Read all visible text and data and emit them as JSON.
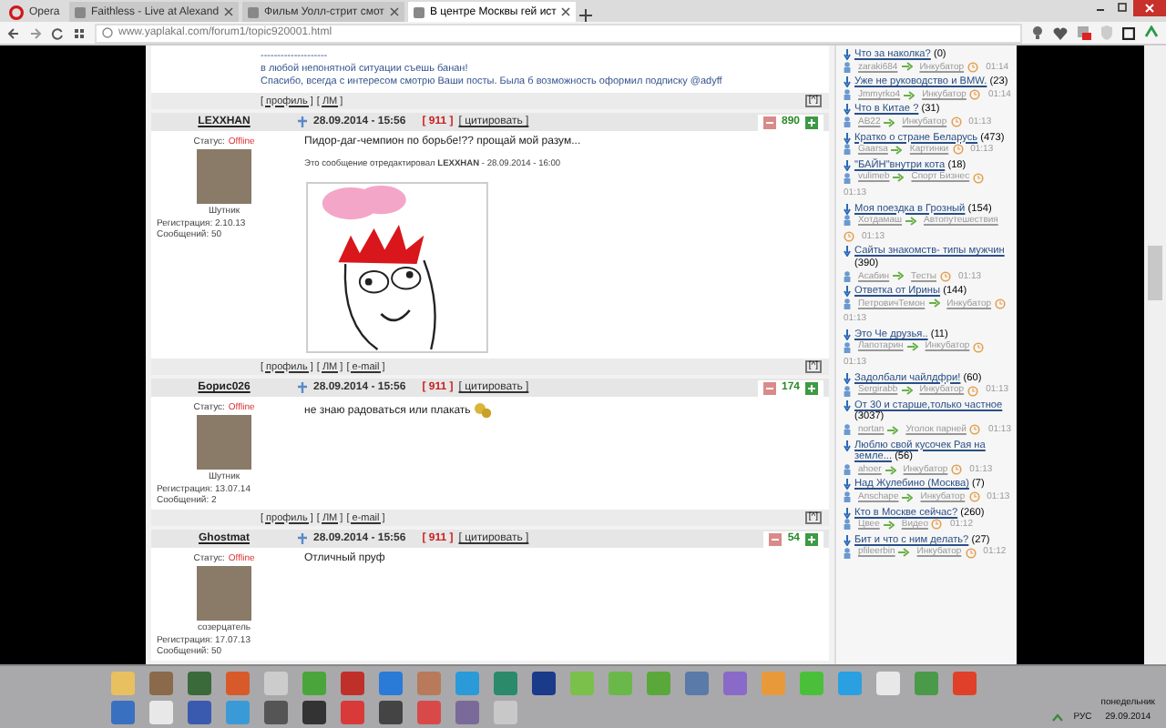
{
  "browser": {
    "tabs": [
      {
        "label": "Opera",
        "kind": "menu",
        "selected": false
      },
      {
        "label": "Faithless - Live at Alexand",
        "kind": "page",
        "selected": false
      },
      {
        "label": "Фильм Уолл-стрит смот",
        "kind": "page",
        "selected": false
      },
      {
        "label": "В центре Москвы гей ист",
        "kind": "page",
        "selected": true
      }
    ],
    "address": "www.yaplakal.com/forum1/topic920001.html"
  },
  "forum": {
    "top_fragment": {
      "lines": [
        "--------------------",
        "в любой непонятной ситуации съешь банан!",
        "Спасибо, всегда с интересом смотрю Ваши посты. Была б возможность оформил подписку @adyff"
      ],
      "links": [
        "[ профиль ]",
        "[ ЛМ ]"
      ],
      "top_button": "[^]"
    },
    "posts": [
      {
        "user": "LEXXHAN",
        "status_label": "Статус:",
        "status": "Offline",
        "rank": "Шутник",
        "registered": "Регистрация: 2.10.13",
        "messages": "Сообщений: 50",
        "date": "28.09.2014 - 15:56",
        "number": "[ 911 ]",
        "quote": "[ цитировать ]",
        "rating": "890",
        "text": "Пидор-даг-чемпион по борьбе!?? прощай мой разум...",
        "edited": "Это сообщение отредактировал **LEXXHAN** - 28.09.2014 - 16:00",
        "has_image": true,
        "has_emoticon": false,
        "links": [
          "[ профиль ]",
          "[ ЛМ ]",
          "[ e-mail ]"
        ],
        "top_button": "[^]"
      },
      {
        "user": "Борис026",
        "status_label": "Статус:",
        "status": "Offline",
        "rank": "Шутник",
        "registered": "Регистрация: 13.07.14",
        "messages": "Сообщений: 2",
        "date": "28.09.2014 - 15:56",
        "number": "[ 911 ]",
        "quote": "[ цитировать ]",
        "rating": "174",
        "text": "не знаю радоваться или плакать",
        "has_image": false,
        "has_emoticon": true,
        "links": [
          "[ профиль ]",
          "[ ЛМ ]",
          "[ e-mail ]"
        ],
        "top_button": "[^]"
      },
      {
        "user": "Ghostmat",
        "status_label": "Статус:",
        "status": "Offline",
        "rank": "созерцатель",
        "registered": "Регистрация: 17.07.13",
        "messages": "Сообщений: 50",
        "date": "28.09.2014 - 15:56",
        "number": "[ 911 ]",
        "quote": "[ цитировать ]",
        "rating": "54",
        "text": "Отличный пруф",
        "has_image": false,
        "has_emoticon": false
      }
    ]
  },
  "sidebar": {
    "topics": [
      {
        "title": "Что за наколка?",
        "count": "(0)",
        "author": "zaraki684",
        "forum": "Инкубатор",
        "time": "01:14"
      },
      {
        "title": "Уже не руководство и BMW.",
        "count": "(23)",
        "author": "Jmmyrko4",
        "forum": "Инкубатор",
        "time": "01:14"
      },
      {
        "title": "Что в Китае ?",
        "count": "(31)",
        "author": "AB22",
        "forum": "Инкубатор",
        "time": "01:13"
      },
      {
        "title": "Кратко о стране Беларусь",
        "count": "(473)",
        "author": "Gaarsa",
        "forum": "Картинки",
        "time": "01:13"
      },
      {
        "title": "\"БАЙН\"внутри кота",
        "count": "(18)",
        "author": "vulimeb",
        "forum": "Спорт Бизнес",
        "time": "01:13"
      },
      {
        "title": "Моя поездка в Грозный",
        "count": "(154)",
        "author": "Хотдамаш",
        "forum": "Автопутешествия",
        "time": "01:13"
      },
      {
        "title": "Сайты знакомств- типы мужчин",
        "count": "(390)",
        "author": "Асабин",
        "forum": "Тесты",
        "time": "01:13"
      },
      {
        "title": "Ответка от Ирины",
        "count": "(144)",
        "author": "ПетровичТемон",
        "forum": "Инкубатор",
        "time": "01:13"
      },
      {
        "title": "Это Че друзья..",
        "count": "(11)",
        "author": "Лапотарин",
        "forum": "Инкубатор",
        "time": "01:13"
      },
      {
        "title": "Задолбали чайлдфри!",
        "count": "(60)",
        "author": "Sergirabb",
        "forum": "Инкубатор",
        "time": "01:13"
      },
      {
        "title": "От 30 и старше,только частное",
        "count": "(3037)",
        "author": "nortan",
        "forum": "Уголок парней",
        "time": "01:13"
      },
      {
        "title": "Люблю свой кусочек Рая на земле...",
        "count": "(56)",
        "author": "ahoer",
        "forum": "Инкубатор",
        "time": "01:13"
      },
      {
        "title": "Над Жулебино (Москва)",
        "count": "(7)",
        "author": "Anschape",
        "forum": "Инкубатор",
        "time": "01:13"
      },
      {
        "title": "Кто в Москве сейчас?",
        "count": "(260)",
        "author": "Цвее",
        "forum": "Видео",
        "time": "01:12"
      },
      {
        "title": "Бит и что с ним делать?",
        "count": "(27)",
        "author": "pfileerbin",
        "forum": "Инкубатор",
        "time": "01:12"
      }
    ]
  },
  "taskbar": {
    "language": "РУС",
    "day": "понедельник",
    "date": "29.09.2014"
  }
}
